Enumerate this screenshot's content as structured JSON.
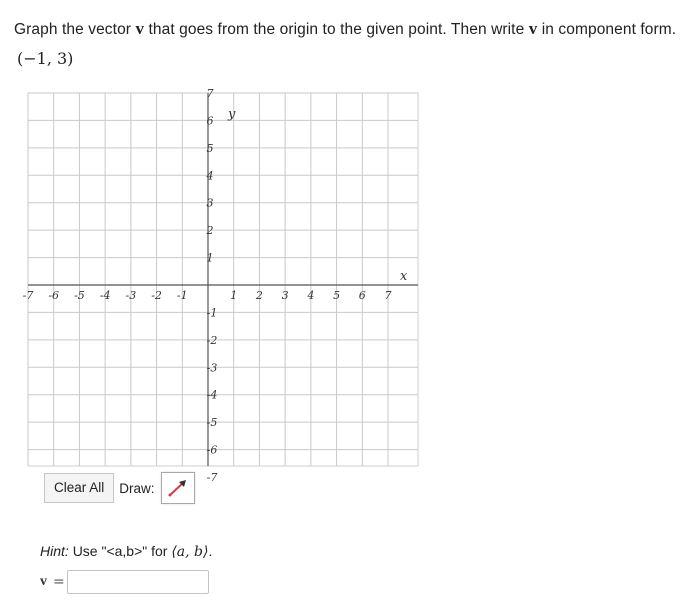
{
  "instruction": {
    "part1": "Graph the vector ",
    "vec1": "v",
    "part2": " that goes from the origin to the given point. Then write ",
    "vec2": "v",
    "part3": " in component form."
  },
  "point": "(−1, 3)",
  "graph": {
    "x_axis_label": "x",
    "y_axis_label": "y",
    "x_ticks_neg": [
      "-7",
      "-6",
      "-5",
      "-4",
      "-3",
      "-2",
      "-1"
    ],
    "x_ticks_pos": [
      "1",
      "2",
      "3",
      "4",
      "5",
      "6",
      "7"
    ],
    "y_ticks_pos": [
      "1",
      "2",
      "3",
      "4",
      "5",
      "6",
      "7"
    ],
    "y_ticks_neg": [
      "-1",
      "-2",
      "-3",
      "-4",
      "-5",
      "-6",
      "-7"
    ],
    "range": [
      -7,
      7
    ]
  },
  "toolbar": {
    "clear_label": "Clear All",
    "draw_label": "Draw:",
    "draw_tool_icon": "vector-arrow-icon",
    "accent": "#d63a4a"
  },
  "hint": {
    "prefix": "Hint: ",
    "text": "Use \"<a,b>\" for ",
    "math": "⟨a, b⟩",
    "suffix": "."
  },
  "answer": {
    "label": "v",
    "equals": "=",
    "value": ""
  }
}
